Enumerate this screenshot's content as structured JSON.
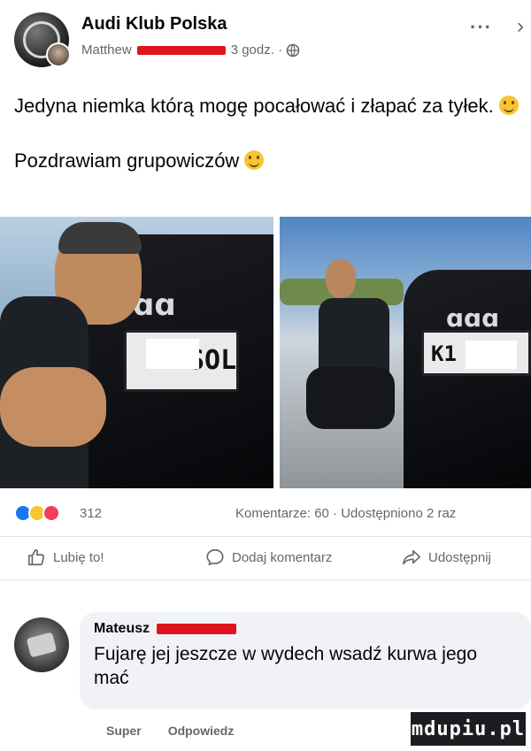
{
  "header": {
    "group_name": "Audi Klub Polska",
    "author_prefix": "Matthew",
    "time": "3 godz. ·",
    "more_label": "···",
    "close_label": "›"
  },
  "post": {
    "text_line1": "Jedyna niemka którą mogę pocałować i złapać za tyłek.",
    "text_line2": "Pozdrawiam grupowiczów"
  },
  "photos": {
    "left_plate_text": "SOL",
    "right_plate_text": "K1",
    "rings_left": "ɑɑ",
    "rings_right": "ɑɑɑ"
  },
  "stats": {
    "reaction_count": "312",
    "comments_shares": "Komentarze: 60 · Udostępniono 2 raz"
  },
  "actions": {
    "like": "Lubię to!",
    "comment": "Dodaj komentarz",
    "share": "Udostępnij"
  },
  "comment": {
    "author_prefix": "Mateusz",
    "text": "Fujarę jej jeszcze w wydech wsadź kurwa jego mać",
    "link_super": "Super",
    "link_reply": "Odpowiedz"
  },
  "watermark": "mdupiu.pl",
  "colors": {
    "like_blue": "#1877f2",
    "redaction_red": "#e0141e",
    "text_secondary": "#65676b"
  },
  "icons": [
    "globe-icon",
    "like-reaction-icon",
    "haha-reaction-icon",
    "love-reaction-icon",
    "thumbs-up-icon",
    "comment-icon",
    "share-icon"
  ]
}
